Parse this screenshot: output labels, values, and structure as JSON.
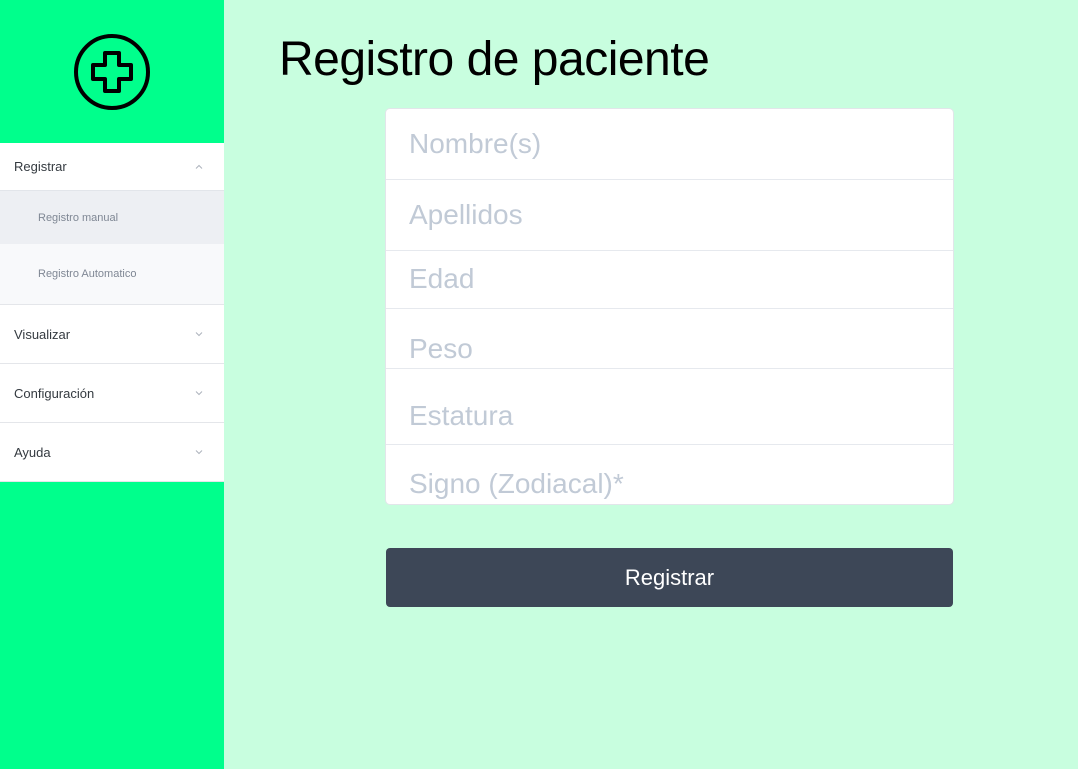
{
  "sidebar": {
    "logo_icon": "medical-cross-icon",
    "menu": [
      {
        "label": "Registrar",
        "icon": "chevron-up-icon",
        "expanded": true,
        "subitems": [
          {
            "label": "Registro manual",
            "active": true
          },
          {
            "label": "Registro Automatico",
            "active": false
          }
        ]
      },
      {
        "label": "Visualizar",
        "icon": "chevron-down-icon",
        "expanded": false
      },
      {
        "label": "Configuración",
        "icon": "chevron-down-icon",
        "expanded": false
      },
      {
        "label": "Ayuda",
        "icon": "chevron-down-icon",
        "expanded": false
      }
    ]
  },
  "main": {
    "title": "Registro de paciente",
    "form": {
      "fields": [
        {
          "placeholder": "Nombre(s)",
          "value": ""
        },
        {
          "placeholder": "Apellidos",
          "value": ""
        },
        {
          "placeholder": "Edad",
          "value": ""
        },
        {
          "placeholder": "Peso",
          "value": ""
        },
        {
          "placeholder": "Estatura",
          "value": ""
        },
        {
          "placeholder": "Signo (Zodiacal)*",
          "value": ""
        }
      ],
      "submit_label": "Registrar"
    }
  },
  "colors": {
    "sidebar_bg": "#00ff8c",
    "page_bg": "#c8fedf",
    "button_bg": "#3d4757",
    "placeholder": "#c1cad6"
  }
}
